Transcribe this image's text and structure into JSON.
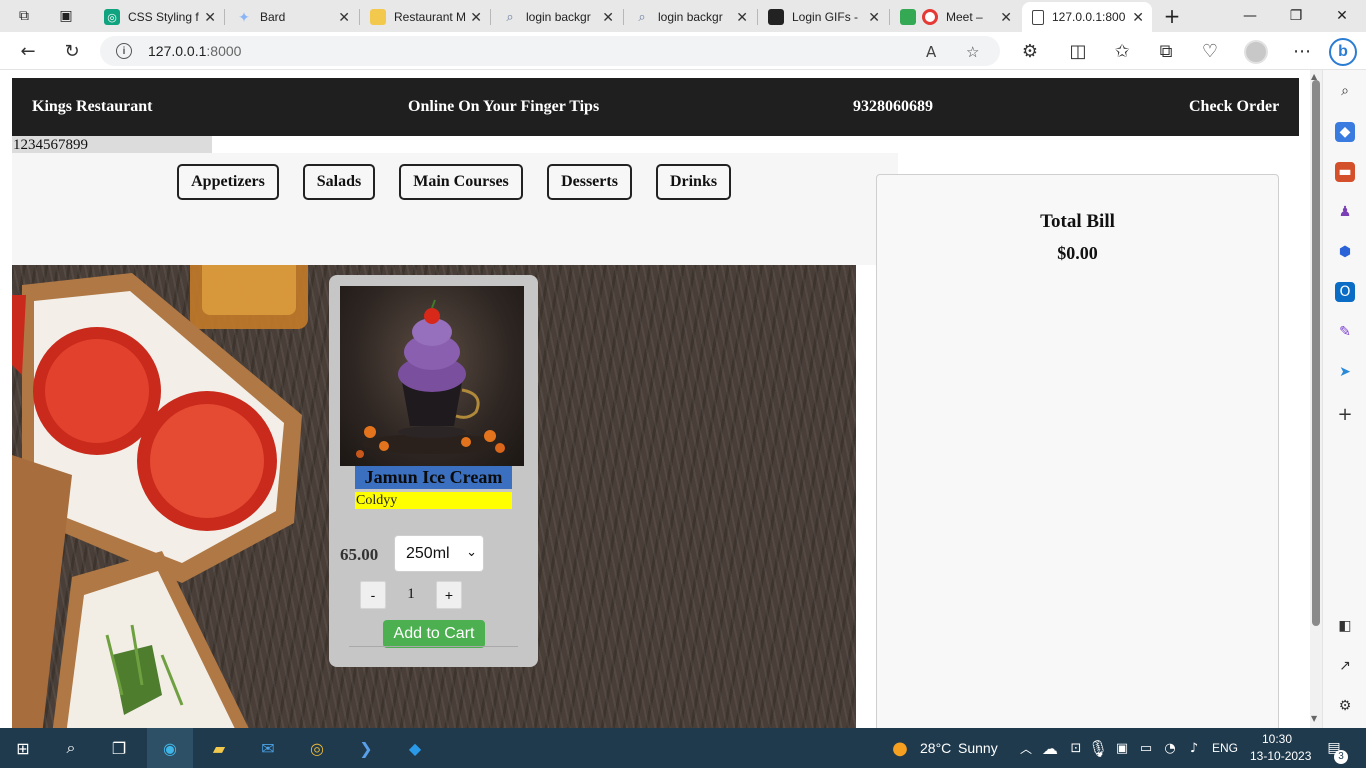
{
  "browser": {
    "tabs": [
      {
        "title": "CSS Styling f",
        "color": "#10a37f",
        "glyph": "◎"
      },
      {
        "title": "Bard",
        "color": "#8ab4f8",
        "glyph": "✦"
      },
      {
        "title": "Restaurant M",
        "color": "#f2c94c",
        "glyph": "▭"
      },
      {
        "title": "login backgr",
        "color": "#8aa4c8",
        "glyph": "⌕"
      },
      {
        "title": "login backgr",
        "color": "#8aa4c8",
        "glyph": "⌕"
      },
      {
        "title": "Login GIFs - ",
        "color": "#222222",
        "glyph": "▮"
      },
      {
        "title": "Meet –",
        "color": "#e53935",
        "glyph": "●"
      },
      {
        "title": "127.0.0.1:800",
        "color": "#ffffff",
        "glyph": "🗋"
      }
    ],
    "url_host": "127.0.0.1",
    "url_port": ":8000"
  },
  "header": {
    "brand": "Kings Restaurant",
    "tagline": "Online On Your Finger Tips",
    "phone": "9328060689",
    "check_order": "Check Order"
  },
  "id_strip": "1234567899",
  "categories": [
    "Appetizers",
    "Salads",
    "Main Courses",
    "Desserts",
    "Drinks"
  ],
  "bill": {
    "title": "Total Bill",
    "amount": "$0.00"
  },
  "product": {
    "name": "Jamun Ice Cream",
    "tag": "Coldyy",
    "price": "65.00",
    "size": "250ml",
    "qty": "1",
    "minus": "-",
    "plus": "+",
    "add_to_cart": "Add to Cart"
  },
  "taskbar": {
    "weather_temp": "28°C",
    "weather_text": "Sunny",
    "lang": "ENG",
    "time": "10:30",
    "date": "13-10-2023",
    "notif_count": "3"
  },
  "colors": {
    "header_bg": "#1f1f1f",
    "name_bg": "#3b6fbf",
    "tag_bg": "#ffff00",
    "cart_btn": "#4caf50",
    "taskbar_bg": "#1f3a4d"
  }
}
